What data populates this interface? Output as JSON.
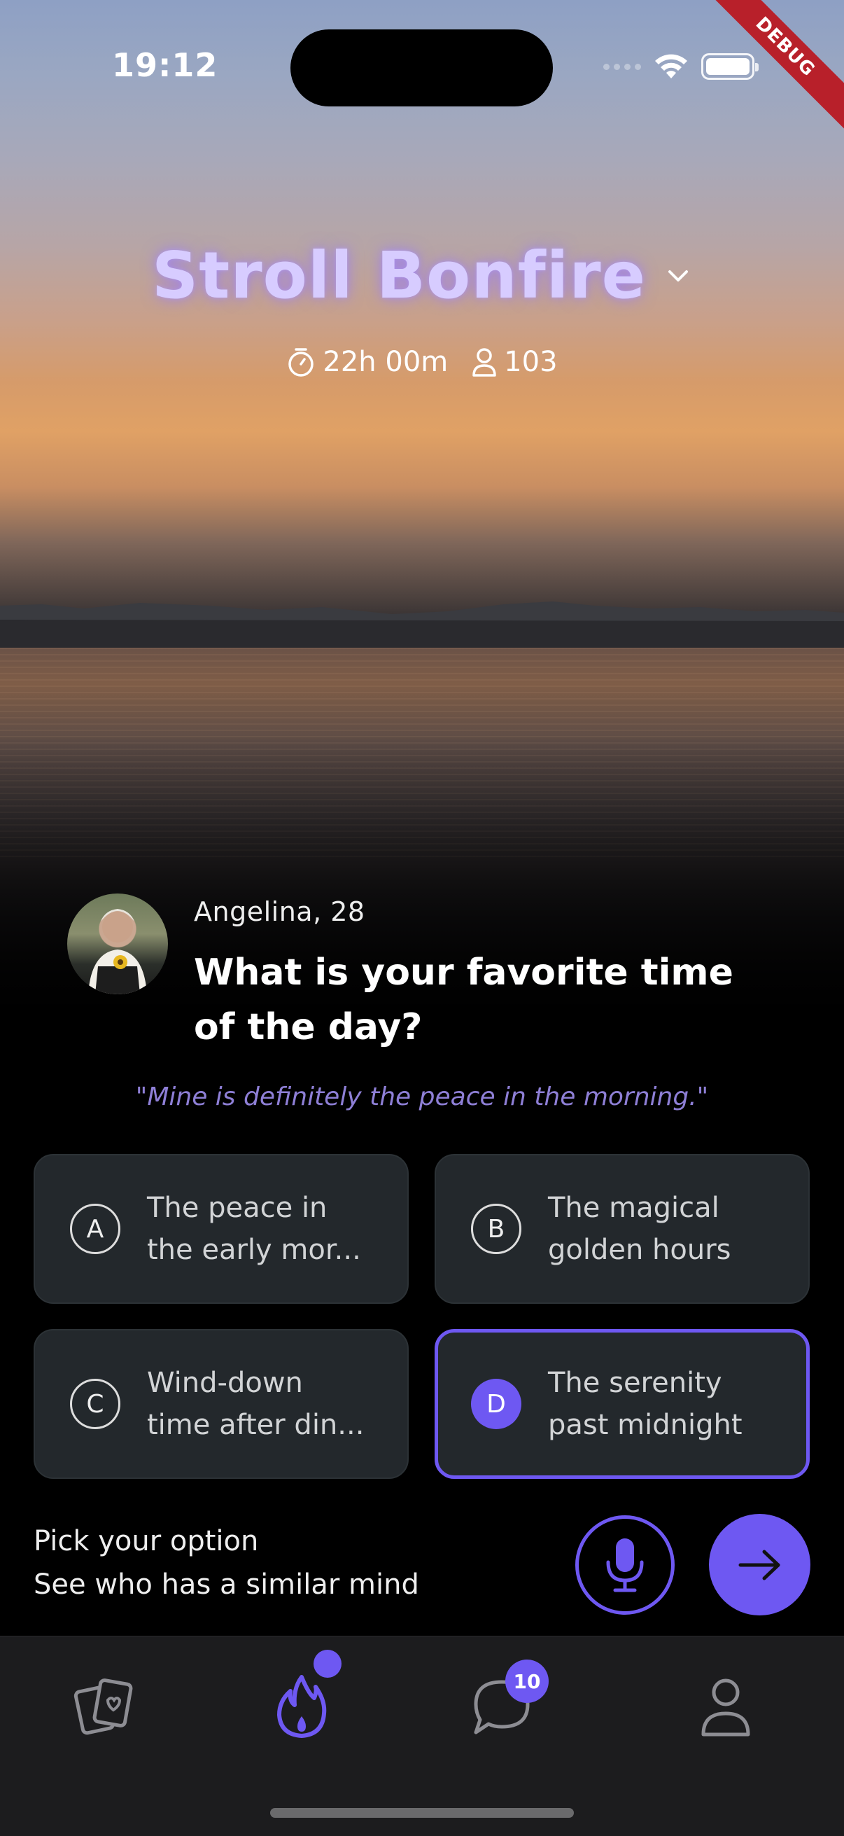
{
  "status_bar": {
    "time": "19:12",
    "debug_label": "DEBUG"
  },
  "header": {
    "title": "Stroll Bonfire",
    "timer": "22h 00m",
    "participants": "103"
  },
  "post": {
    "author": "Angelina, 28",
    "question": "What is your favorite time of the day?",
    "quote": "\"Mine is definitely the peace in the morning.\""
  },
  "options": [
    {
      "letter": "A",
      "text": "The peace in\nthe early mor..."
    },
    {
      "letter": "B",
      "text": "The magical\ngolden hours"
    },
    {
      "letter": "C",
      "text": "Wind-down\ntime after din..."
    },
    {
      "letter": "D",
      "text": "The serenity\npast midnight",
      "selected": true
    }
  ],
  "prompt": {
    "title": "Pick your option",
    "subtitle": "See who has a similar mind"
  },
  "tabbar": {
    "items": [
      "cards-icon",
      "flame-icon",
      "chat-icon",
      "profile-icon"
    ],
    "chat_badge": "10"
  },
  "colors": {
    "accent": "#6e58f2",
    "title": "#d7ccff",
    "option_bg": "#23282c"
  }
}
